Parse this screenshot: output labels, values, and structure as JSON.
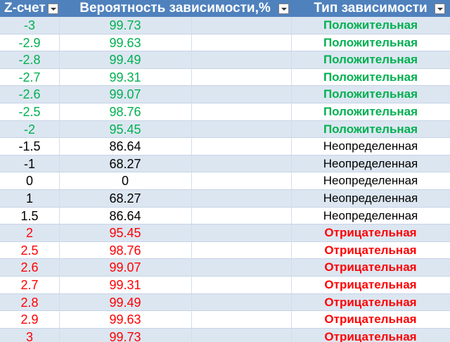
{
  "header": {
    "col_z": "Z-счет",
    "col_prob": "Вероятность зависимости,%",
    "col_type": "Тип зависимости"
  },
  "colors": {
    "header_bg": "#4f81bd",
    "band": "#dce6f1",
    "positive": "#00b050",
    "negative": "#ff0000",
    "neutral": "#000000"
  },
  "rows": [
    {
      "z": "-3",
      "p": "99.73",
      "type": "Положительная",
      "kind": "pos"
    },
    {
      "z": "-2.9",
      "p": "99.63",
      "type": "Положительная",
      "kind": "pos"
    },
    {
      "z": "-2.8",
      "p": "99.49",
      "type": "Положительная",
      "kind": "pos"
    },
    {
      "z": "-2.7",
      "p": "99.31",
      "type": "Положительная",
      "kind": "pos"
    },
    {
      "z": "-2.6",
      "p": "99.07",
      "type": "Положительная",
      "kind": "pos"
    },
    {
      "z": "-2.5",
      "p": "98.76",
      "type": "Положительная",
      "kind": "pos"
    },
    {
      "z": "-2",
      "p": "95.45",
      "type": "Положительная",
      "kind": "pos"
    },
    {
      "z": "-1.5",
      "p": "86.64",
      "type": "Неопределенная",
      "kind": "neu"
    },
    {
      "z": "-1",
      "p": "68.27",
      "type": "Неопределенная",
      "kind": "neu"
    },
    {
      "z": "0",
      "p": "0",
      "type": "Неопределенная",
      "kind": "neu"
    },
    {
      "z": "1",
      "p": "68.27",
      "type": "Неопределенная",
      "kind": "neu"
    },
    {
      "z": "1.5",
      "p": "86.64",
      "type": "Неопределенная",
      "kind": "neu"
    },
    {
      "z": "2",
      "p": "95.45",
      "type": "Отрицательная",
      "kind": "neg"
    },
    {
      "z": "2.5",
      "p": "98.76",
      "type": "Отрицательная",
      "kind": "neg"
    },
    {
      "z": "2.6",
      "p": "99.07",
      "type": "Отрицательная",
      "kind": "neg"
    },
    {
      "z": "2.7",
      "p": "99.31",
      "type": "Отрицательная",
      "kind": "neg"
    },
    {
      "z": "2.8",
      "p": "99.49",
      "type": "Отрицательная",
      "kind": "neg"
    },
    {
      "z": "2.9",
      "p": "99.63",
      "type": "Отрицательная",
      "kind": "neg"
    },
    {
      "z": "3",
      "p": "99.73",
      "type": "Отрицательная",
      "kind": "neg"
    }
  ]
}
